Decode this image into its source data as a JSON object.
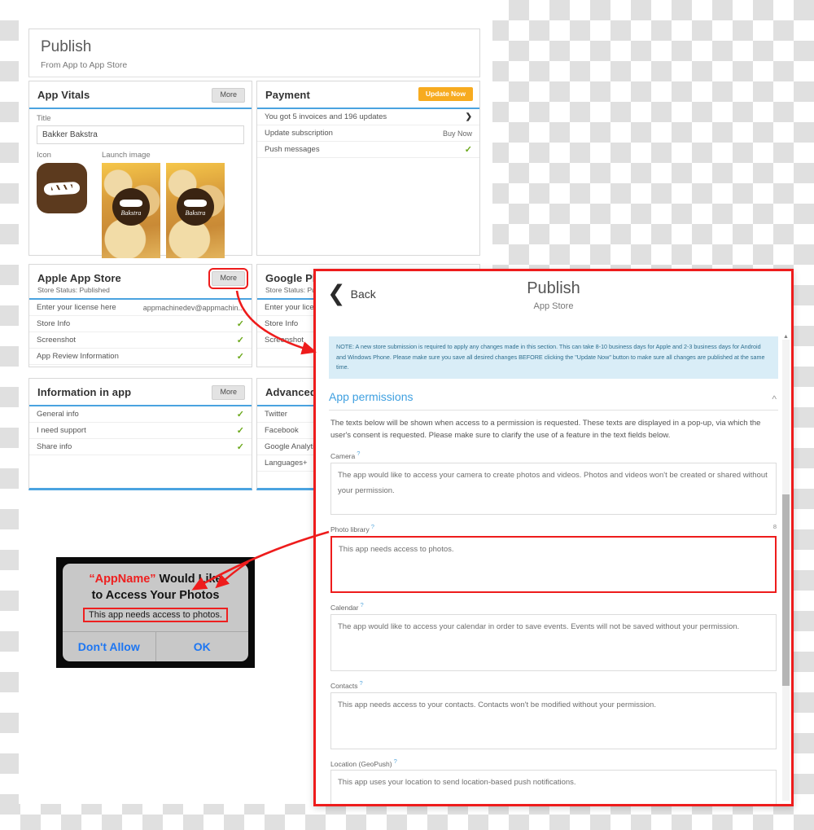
{
  "page": {
    "header_title": "Publish",
    "header_subtitle": "From App to App Store"
  },
  "cards": {
    "app_vitals": {
      "title": "App Vitals",
      "more_label": "More",
      "title_field_label": "Title",
      "title_field_value": "Bakker Bakstra",
      "icon_label": "Icon",
      "launch_image_label": "Launch image",
      "launch_badge_text": "Bakstra"
    },
    "payment": {
      "title": "Payment",
      "update_button": "Update Now",
      "rows": [
        {
          "label": "You got 5 invoices and 196 updates",
          "value": "❯",
          "value_type": "chevron"
        },
        {
          "label": "Update subscription",
          "value": "Buy Now",
          "value_type": "text"
        },
        {
          "label": "Push messages",
          "value": "✓",
          "value_type": "check"
        }
      ]
    },
    "apple_app_store": {
      "title": "Apple App Store",
      "status": "Store Status: Published",
      "more_label": "More",
      "rows": [
        {
          "label": "Enter your license here",
          "value": "appmachinedev@appmachin...",
          "value_type": "text"
        },
        {
          "label": "Store Info",
          "value": "✓",
          "value_type": "check"
        },
        {
          "label": "Screenshot",
          "value": "✓",
          "value_type": "check"
        },
        {
          "label": "App Review Information",
          "value": "✓",
          "value_type": "check"
        }
      ]
    },
    "google_play": {
      "title": "Google Play",
      "status": "Store Status: Published",
      "rows": [
        {
          "label": "Enter your license here"
        },
        {
          "label": "Store Info"
        },
        {
          "label": "Screenshot"
        }
      ]
    },
    "information_in_app": {
      "title": "Information in app",
      "more_label": "More",
      "rows": [
        {
          "label": "General info",
          "value": "✓",
          "value_type": "check"
        },
        {
          "label": "I need support",
          "value": "✓",
          "value_type": "check"
        },
        {
          "label": "Share info",
          "value": "✓",
          "value_type": "check"
        }
      ]
    },
    "advanced": {
      "title": "Advanced",
      "rows": [
        {
          "label": "Twitter"
        },
        {
          "label": "Facebook"
        },
        {
          "label": "Google Analytics"
        },
        {
          "label": "Languages+"
        }
      ]
    }
  },
  "modal": {
    "back_label": "Back",
    "title": "Publish",
    "subtitle": "App Store",
    "note": "NOTE: A new store submission is required to apply any changes made in this section. This can take 8-10 business days for Apple and 2-3 business days for Android and Windows Phone. Please make sure you save all desired changes BEFORE clicking the \"Update Now\" button to make sure all changes are published at the same time.",
    "section_title": "App permissions",
    "section_description": "The texts below will be shown when access to a permission is requested. These texts are displayed in a pop-up, via which the user's consent is requested. Please make sure to clarify the use of a feature in the text fields below.",
    "permissions": [
      {
        "label": "Camera",
        "help": "?",
        "value": "The app would like to access your camera to create photos and videos. Photos and videos won't be created or shared without your permission.",
        "counter": "",
        "highlighted": false
      },
      {
        "label": "Photo library",
        "help": "?",
        "value": "This app needs access to photos.",
        "counter": "8",
        "highlighted": true
      },
      {
        "label": "Calendar",
        "help": "?",
        "value": "The app would like to access your calendar in order to save events. Events will not be saved without your permission.",
        "counter": "",
        "highlighted": false
      },
      {
        "label": "Contacts",
        "help": "?",
        "value": "This app needs access to your contacts. Contacts won't be modified without your permission.",
        "counter": "",
        "highlighted": false
      },
      {
        "label": "Location (GeoPush)",
        "help": "?",
        "value": "This app uses your location to send location-based push notifications.",
        "counter": "",
        "highlighted": false
      }
    ]
  },
  "ios_alert": {
    "app_name": "“AppName”",
    "title_rest": " Would Like",
    "title_line2": "to Access Your Photos",
    "message": "This app needs access to photos.",
    "deny_label": "Don't Allow",
    "ok_label": "OK"
  },
  "colors": {
    "accent_blue": "#4aa3e0",
    "link_blue": "#3fa0e0",
    "highlight_red": "#ee1c1c",
    "check_green": "#6aa81a",
    "orange": "#f7ab1f",
    "note_bg": "#d9edf7",
    "icon_brown": "#5c3a1e"
  }
}
